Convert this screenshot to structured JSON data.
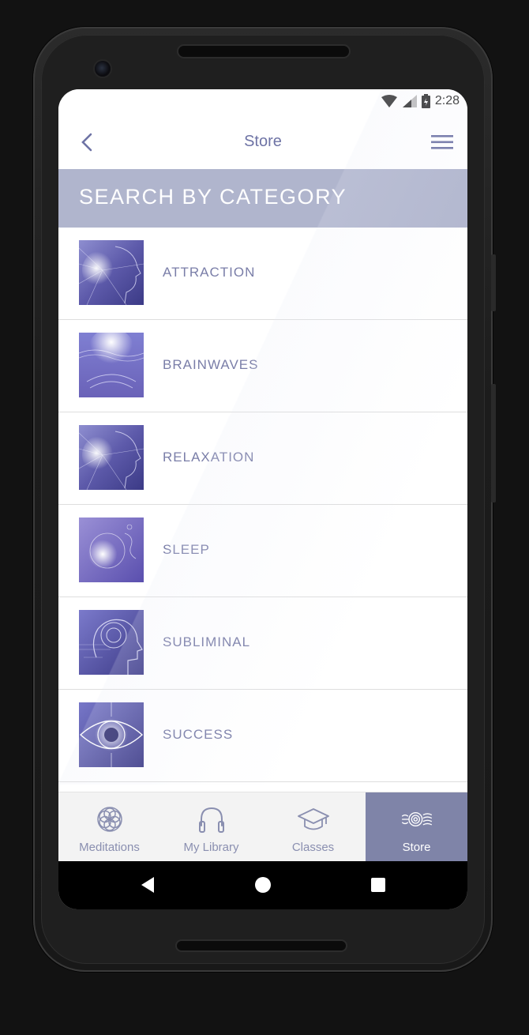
{
  "status_bar": {
    "time": "2:28",
    "icons": [
      "wifi-icon",
      "signal-icon",
      "battery-icon"
    ]
  },
  "app_bar": {
    "title": "Store",
    "back_icon": "chevron-left-icon",
    "menu_icon": "hamburger-menu-icon"
  },
  "section_header": "SEARCH BY CATEGORY",
  "categories": [
    {
      "label": "ATTRACTION",
      "thumb": "face-light-art"
    },
    {
      "label": "BRAINWAVES",
      "thumb": "glowing-head-art"
    },
    {
      "label": "RELAXATION",
      "thumb": "face-light-art"
    },
    {
      "label": "SLEEP",
      "thumb": "glowing-brain-art"
    },
    {
      "label": "SUBLIMINAL",
      "thumb": "head-profile-art"
    },
    {
      "label": "SUCCESS",
      "thumb": "eye-art"
    }
  ],
  "tabs": [
    {
      "label": "Meditations",
      "icon": "mandala-icon"
    },
    {
      "label": "My Library",
      "icon": "headphones-icon"
    },
    {
      "label": "Classes",
      "icon": "graduation-cap-icon"
    },
    {
      "label": "Store",
      "icon": "waves-spiral-icon",
      "active": true
    }
  ],
  "colors": {
    "accent": "#7f84a8",
    "header": "#b0b5cd",
    "text": "#7a7ea8"
  }
}
